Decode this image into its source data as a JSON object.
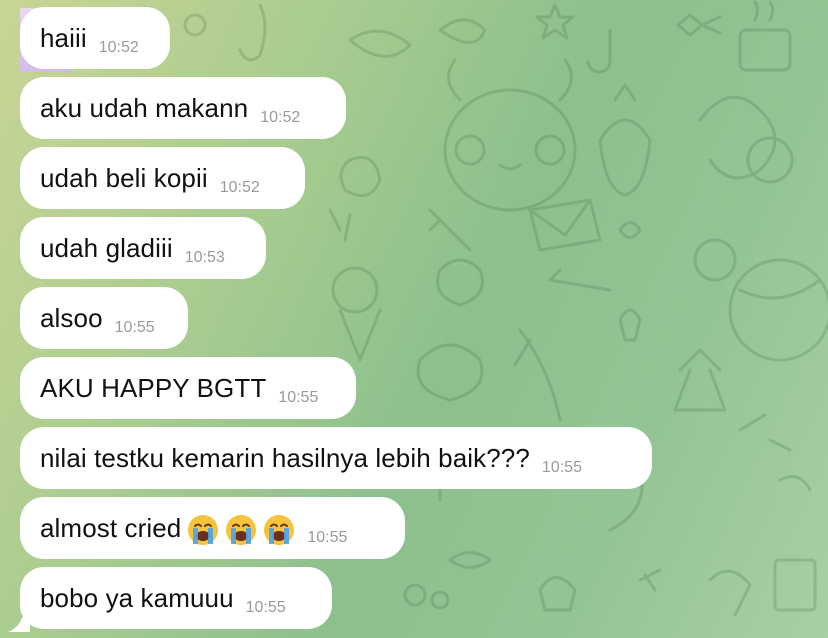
{
  "chat": {
    "messages": [
      {
        "text": "haiii",
        "time": "10:52"
      },
      {
        "text": "aku udah makann",
        "time": "10:52"
      },
      {
        "text": "udah beli kopii",
        "time": "10:52"
      },
      {
        "text": "udah gladiii",
        "time": "10:53"
      },
      {
        "text": "alsoo",
        "time": "10:55"
      },
      {
        "text": "AKU HAPPY BGTT",
        "time": "10:55"
      },
      {
        "text": "nilai testku kemarin hasilnya lebih baik???",
        "time": "10:55"
      },
      {
        "text": "almost cried",
        "time": "10:55",
        "emojis": [
          "loudly-crying-face-emoji",
          "loudly-crying-face-emoji",
          "loudly-crying-face-emoji"
        ]
      },
      {
        "text": "bobo ya kamuuu",
        "time": "10:55"
      }
    ]
  },
  "colors": {
    "bubble": "#ffffff",
    "timestamp": "#9a9a9a",
    "wallpaper_start": "#c8d596",
    "wallpaper_end": "#a9cfa6"
  }
}
